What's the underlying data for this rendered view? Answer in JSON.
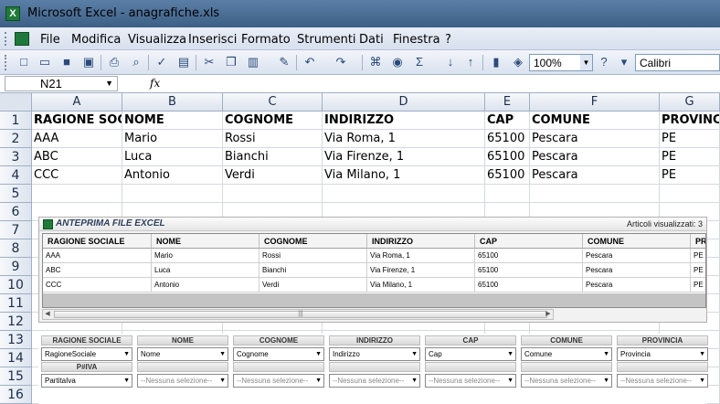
{
  "window": {
    "title": "Microsoft Excel - anagrafiche.xls"
  },
  "menu": [
    "File",
    "Modifica",
    "Visualizza",
    "Inserisci",
    "Formato",
    "Strumenti",
    "Dati",
    "Finestra",
    "?"
  ],
  "toolbar": {
    "zoom": "100%",
    "font": "Calibri",
    "sum_icon": "Σ"
  },
  "formula_bar": {
    "cell_ref": "N21",
    "fx": "fx",
    "value": ""
  },
  "sheet": {
    "columns": [
      "A",
      "B",
      "C",
      "D",
      "E",
      "F",
      "G"
    ],
    "row_numbers": [
      "1",
      "2",
      "3",
      "4",
      "5",
      "6",
      "7",
      "8",
      "9",
      "10",
      "11",
      "12",
      "13",
      "14",
      "15",
      "16"
    ],
    "rows": [
      [
        "RAGIONE SOCIALE",
        "NOME",
        "COGNOME",
        "INDIRIZZO",
        "CAP",
        "COMUNE",
        "PROVINCIA"
      ],
      [
        "AAA",
        "Mario",
        "Rossi",
        "Via Roma, 1",
        "65100",
        "Pescara",
        "PE"
      ],
      [
        "ABC",
        "Luca",
        "Bianchi",
        "Via Firenze, 1",
        "65100",
        "Pescara",
        "PE"
      ],
      [
        "CCC",
        "Antonio",
        "Verdi",
        "Via Milano, 1",
        "65100",
        "Pescara",
        "PE"
      ]
    ]
  },
  "preview": {
    "title": "ANTEPRIMA FILE EXCEL",
    "count_label": "Articoli visualizzati: 3",
    "headers": [
      "RAGIONE SOCIALE",
      "NOME",
      "COGNOME",
      "INDIRIZZO",
      "CAP",
      "COMUNE",
      "PR"
    ],
    "rows": [
      [
        "AAA",
        "Mario",
        "Rossi",
        "Via Roma, 1",
        "65100",
        "Pescara",
        "PE"
      ],
      [
        "ABC",
        "Luca",
        "Bianchi",
        "Via Firenze, 1",
        "65100",
        "Pescara",
        "PE"
      ],
      [
        "CCC",
        "Antonio",
        "Verdi",
        "Via Milano, 1",
        "65100",
        "Pescara",
        "PE"
      ]
    ]
  },
  "mapping": {
    "row1": [
      {
        "label": "RAGIONE SOCIALE",
        "value": "RagioneSociale"
      },
      {
        "label": "NOME",
        "value": "Nome"
      },
      {
        "label": "COGNOME",
        "value": "Cognome"
      },
      {
        "label": "INDIRIZZO",
        "value": "Indirizzo"
      },
      {
        "label": "CAP",
        "value": "Cap"
      },
      {
        "label": "COMUNE",
        "value": "Comune"
      },
      {
        "label": "PROVINCIA",
        "value": "Provincia"
      }
    ],
    "row2": [
      {
        "label": "P#IVA",
        "value": "PartitaIva"
      },
      {
        "label": "",
        "value": "--Nessuna selezione--"
      },
      {
        "label": "",
        "value": "--Nessuna selezione--"
      },
      {
        "label": "",
        "value": "--Nessuna selezione--"
      },
      {
        "label": "",
        "value": "--Nessuna selezione--"
      },
      {
        "label": "",
        "value": "--Nessuna selezione--"
      },
      {
        "label": "",
        "value": "--Nessuna selezione--"
      }
    ]
  }
}
